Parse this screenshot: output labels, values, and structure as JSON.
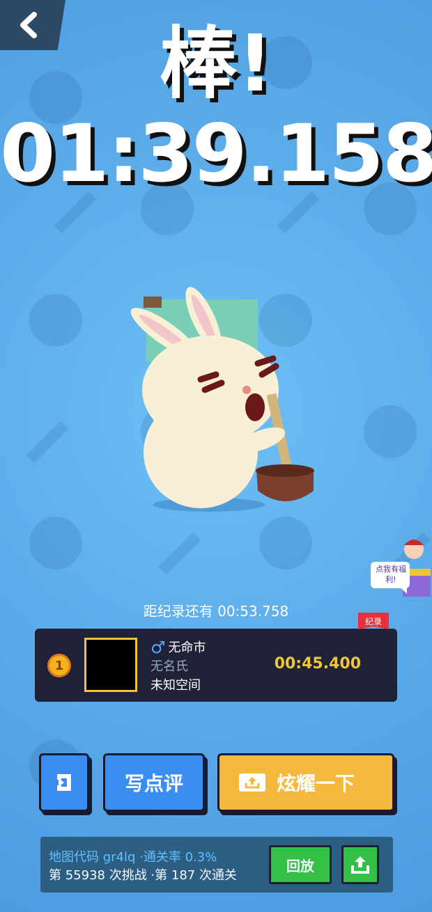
{
  "header": {
    "title": "棒!",
    "time": "01:39.158"
  },
  "record_gap": {
    "label": "距纪录还有",
    "value": "00:53.758"
  },
  "gift_badge": {
    "text": "点我有福利!"
  },
  "record_card": {
    "tag": "纪录",
    "rank": "1",
    "city": "无命市",
    "name": "无名氏",
    "location": "未知空间",
    "time": "00:45.400"
  },
  "actions": {
    "review": "写点评",
    "share": "炫耀一下"
  },
  "footer": {
    "line1": "地图代码 gr4lq ·通关率 0.3%",
    "line2": "第 55938 次挑战 ·第 187 次通关",
    "replay": "回放"
  },
  "colors": {
    "background": "#5fb0ec",
    "card": "#1f2236",
    "accent_gold": "#f2c632",
    "share": "#f4b93c",
    "primary": "#3a8ef2",
    "green": "#33c23e"
  }
}
